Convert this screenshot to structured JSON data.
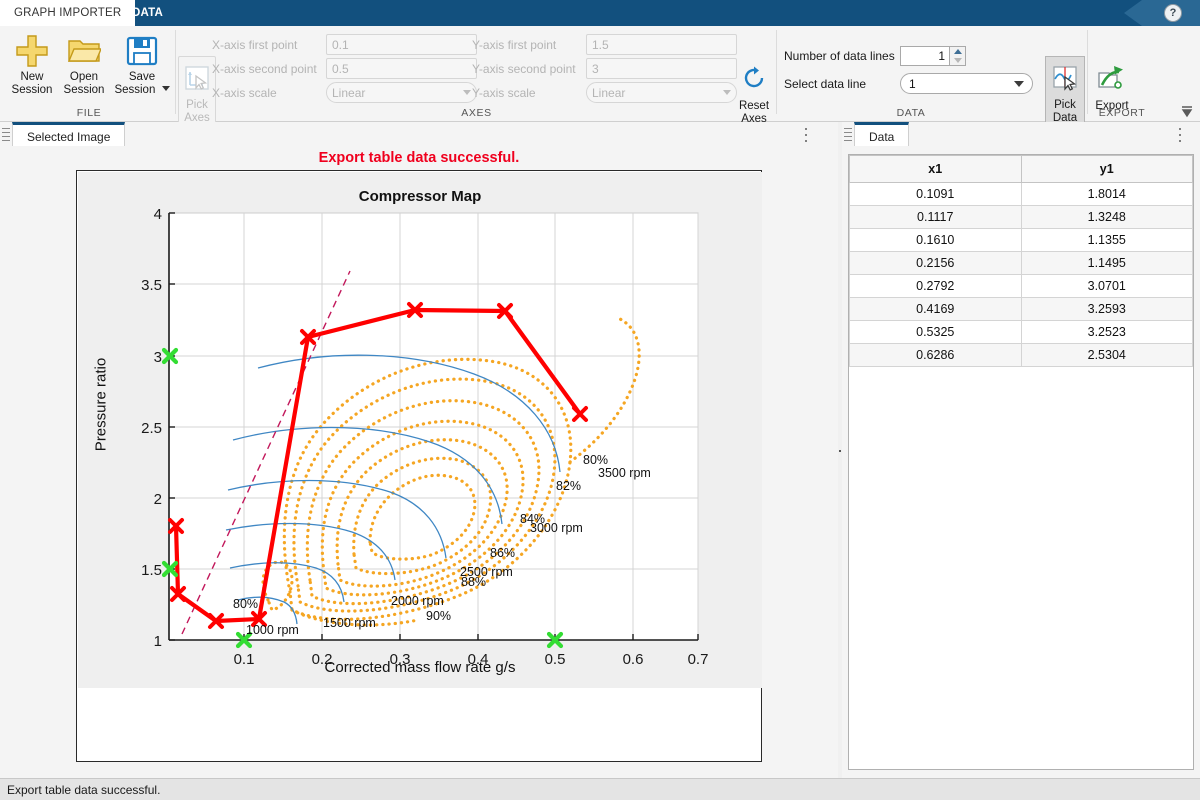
{
  "window": {
    "tab_active": "GRAPH IMPORTER",
    "tab_inactive": "DATA",
    "help_glyph": "?"
  },
  "ribbon": {
    "file": {
      "group_label": "FILE",
      "new_session": "New\nSession",
      "new_session_l1": "New",
      "new_session_l2": "Session",
      "open_session_l1": "Open",
      "open_session_l2": "Session",
      "save_session_l1": "Save",
      "save_session_l2": "Session"
    },
    "axes": {
      "group_label": "AXES",
      "pick_axes_l1": "Pick",
      "pick_axes_l2": "Axes",
      "x_first_label": "X-axis first point",
      "x_first_value": "0.1",
      "x_second_label": "X-axis second point",
      "x_second_value": "0.5",
      "x_scale_label": "X-axis scale",
      "x_scale_value": "Linear",
      "y_first_label": "Y-axis first point",
      "y_first_value": "1.5",
      "y_second_label": "Y-axis second point",
      "y_second_value": "3",
      "y_scale_label": "Y-axis scale",
      "y_scale_value": "Linear",
      "reset_l1": "Reset",
      "reset_l2": "Axes"
    },
    "data": {
      "group_label": "DATA",
      "num_lines_label": "Number of data lines",
      "num_lines_value": "1",
      "select_line_label": "Select data line",
      "select_line_value": "1",
      "pick_data_l1": "Pick",
      "pick_data_l2": "Data"
    },
    "export": {
      "group_label": "EXPORT",
      "export_label": "Export"
    }
  },
  "doc_tabs": {
    "left": "Selected Image",
    "right": "Data"
  },
  "message": "Export table data successful.",
  "statusbar": "Export table data successful.",
  "table": {
    "headers": [
      "x1",
      "y1"
    ],
    "rows": [
      [
        "0.1091",
        "1.8014"
      ],
      [
        "0.1117",
        "1.3248"
      ],
      [
        "0.1610",
        "1.1355"
      ],
      [
        "0.2156",
        "1.1495"
      ],
      [
        "0.2792",
        "3.0701"
      ],
      [
        "0.4169",
        "3.2593"
      ],
      [
        "0.5325",
        "3.2523"
      ],
      [
        "0.6286",
        "2.5304"
      ]
    ]
  },
  "chart_data": {
    "type": "line",
    "title": "Compressor Map",
    "xlabel": "Corrected mass flow rate g/s",
    "ylabel": "Pressure ratio",
    "xlim": [
      0.05,
      0.73
    ],
    "ylim": [
      1,
      4
    ],
    "xticks": [
      "0.1",
      "0.2",
      "0.3",
      "0.4",
      "0.5",
      "0.6",
      "0.7"
    ],
    "xtickvals": [
      0.1,
      0.2,
      0.3,
      0.4,
      0.5,
      0.6,
      0.7
    ],
    "yticks": [
      "1",
      "1.5",
      "2",
      "2.5",
      "3",
      "3.5",
      "4"
    ],
    "ytickvals": [
      1,
      1.5,
      2,
      2.5,
      3,
      3.5,
      4
    ],
    "grid": true,
    "legend": "none",
    "series": [
      {
        "name": "picked-data-line",
        "color": "#ff0000",
        "marker": "x",
        "x": [
          0.1091,
          0.1117,
          0.161,
          0.2156,
          0.2792,
          0.4169,
          0.5325,
          0.6286
        ],
        "y": [
          1.8014,
          1.3248,
          1.1355,
          1.1495,
          3.0701,
          3.2593,
          3.2523,
          2.5304
        ]
      }
    ],
    "calibration_markers": {
      "color": "#33dd33",
      "marker": "x",
      "x_axis_points": [
        0.1,
        0.5
      ],
      "y_axis_points": [
        1.5,
        3.0
      ]
    },
    "surge_line": {
      "color": "#c2185b",
      "style": "dashed",
      "x": [
        0.068,
        0.285
      ],
      "y": [
        1.03,
        3.63
      ]
    },
    "speed_lines": {
      "color": "#3f87c4",
      "labels": [
        "1000 rpm",
        "1500 rpm",
        "2000 rpm",
        "2500 rpm",
        "3000 rpm",
        "3500 rpm"
      ],
      "label_positions": [
        {
          "label": "1000 rpm",
          "x": 0.146,
          "y": 1.055
        },
        {
          "label": "1500 rpm",
          "x": 0.216,
          "y": 1.095
        },
        {
          "label": "2000 rpm",
          "x": 0.305,
          "y": 1.185
        },
        {
          "label": "2500 rpm",
          "x": 0.385,
          "y": 1.34
        },
        {
          "label": "3000 rpm",
          "x": 0.455,
          "y": 1.73
        },
        {
          "label": "3500 rpm",
          "x": 0.525,
          "y": 1.995
        }
      ]
    },
    "efficiency_contours": {
      "color": "#f5a623",
      "style": "dotted",
      "labels": [
        "80%",
        "82%",
        "84%",
        "86%",
        "88%",
        "90%"
      ],
      "label_positions": [
        {
          "label": "80%",
          "x": 0.535,
          "y": 3.04
        },
        {
          "label": "82%",
          "x": 0.493,
          "y": 2.88
        },
        {
          "label": "84%",
          "x": 0.435,
          "y": 2.7
        },
        {
          "label": "86%",
          "x": 0.395,
          "y": 2.5
        },
        {
          "label": "88%",
          "x": 0.358,
          "y": 2.33
        },
        {
          "label": "90%",
          "x": 0.318,
          "y": 2.12
        },
        {
          "label": "80%",
          "x": 0.122,
          "y": 1.19
        }
      ]
    }
  }
}
